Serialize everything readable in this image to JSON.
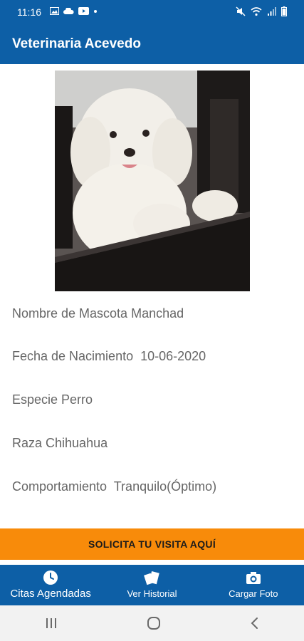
{
  "status_bar": {
    "time": "11:16"
  },
  "app_bar": {
    "title": "Veterinaria Acevedo"
  },
  "pet": {
    "name_line": "Nombre de Mascota Manchad",
    "birth_line": "Fecha de Nacimiento  10-06-2020",
    "species_line": "Especie Perro",
    "breed_line": "Raza Chihuahua",
    "behavior_line": "Comportamiento  Tranquilo(Óptimo)"
  },
  "cta": {
    "label": "SOLICITA TU VISITA AQUÍ"
  },
  "bottom_nav": {
    "items": [
      {
        "label": "Citas Agendadas",
        "icon": "clock-icon"
      },
      {
        "label": "Ver Historial",
        "icon": "cards-icon"
      },
      {
        "label": "Cargar Foto",
        "icon": "camera-icon"
      }
    ]
  },
  "colors": {
    "primary": "#0d5fa6",
    "accent": "#f88b0a"
  }
}
